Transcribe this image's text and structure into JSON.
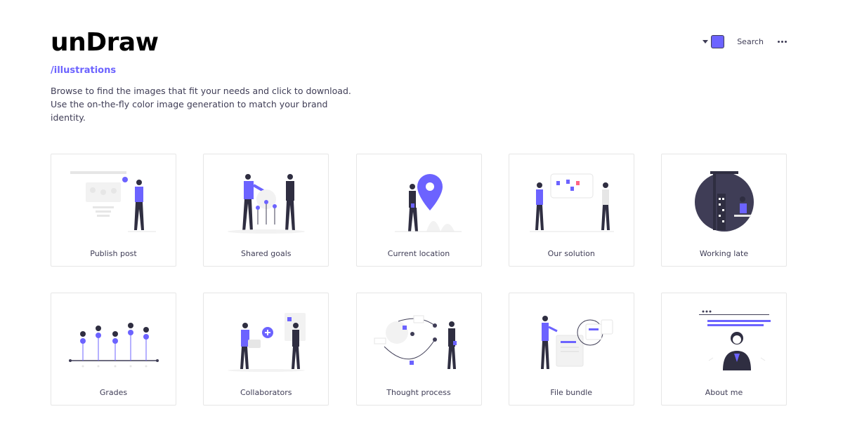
{
  "header": {
    "logo": "unDraw",
    "subtitle": "/illustrations",
    "description": "Browse to find the images that fit your needs and click to download. Use the on-the-fly color image generation to match your brand identity."
  },
  "controls": {
    "color": "#6c63ff",
    "search_label": "Search"
  },
  "cards": [
    {
      "label": "Publish post",
      "icon": "publish-post-illustration"
    },
    {
      "label": "Shared goals",
      "icon": "shared-goals-illustration"
    },
    {
      "label": "Current location",
      "icon": "current-location-illustration"
    },
    {
      "label": "Our solution",
      "icon": "our-solution-illustration"
    },
    {
      "label": "Working late",
      "icon": "working-late-illustration"
    },
    {
      "label": "Grades",
      "icon": "grades-illustration"
    },
    {
      "label": "Collaborators",
      "icon": "collaborators-illustration"
    },
    {
      "label": "Thought process",
      "icon": "thought-process-illustration"
    },
    {
      "label": "File bundle",
      "icon": "file-bundle-illustration"
    },
    {
      "label": "About me",
      "icon": "about-me-illustration"
    }
  ],
  "colors": {
    "accent": "#6c63ff",
    "dark": "#2f2e41",
    "text": "#3f3d56",
    "light": "#e6e6e6",
    "muted": "#f2f2f2",
    "red": "#ff6584"
  }
}
